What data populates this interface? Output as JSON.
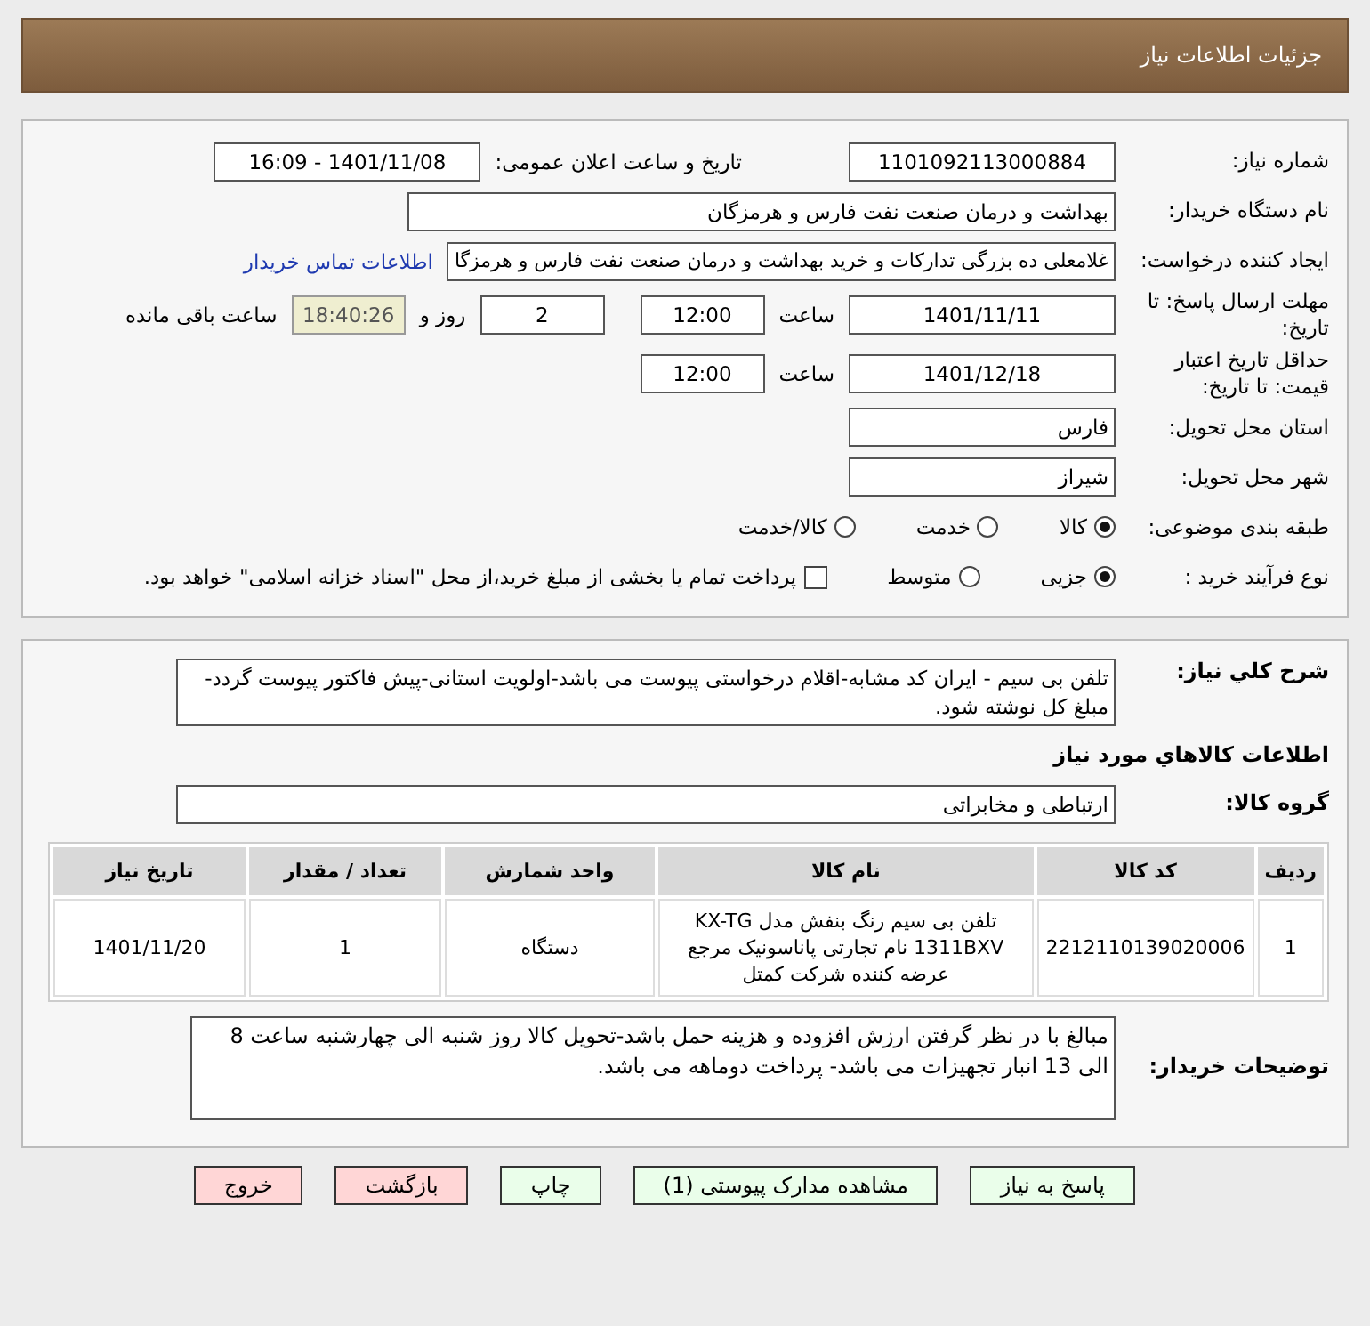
{
  "header": {
    "title": "جزئیات اطلاعات نیاز"
  },
  "need_number": {
    "label": "شماره نیاز:",
    "value": "1101092113000884"
  },
  "announce": {
    "label": "تاریخ و ساعت اعلان عمومی:",
    "value": "1401/11/08 - 16:09"
  },
  "buyer_org": {
    "label": "نام دستگاه خریدار:",
    "value": "بهداشت و درمان صنعت نفت فارس و هرمزگان"
  },
  "requester": {
    "label": "ایجاد کننده درخواست:",
    "value": "غلامعلی ده بزرگی تدارکات و خرید بهداشت و درمان صنعت نفت فارس و هرمزگا",
    "link": "اطلاعات تماس خریدار"
  },
  "reply_deadline": {
    "label": "مهلت ارسال پاسخ: تا تاریخ:",
    "date": "1401/11/11",
    "time_label": "ساعت",
    "time": "12:00",
    "days": "2",
    "days_label": "روز و",
    "remaining": "18:40:26",
    "remaining_label": "ساعت باقی مانده"
  },
  "price_validity": {
    "label": "حداقل تاریخ اعتبار قیمت: تا تاریخ:",
    "date": "1401/12/18",
    "time_label": "ساعت",
    "time": "12:00"
  },
  "province": {
    "label": "استان محل تحویل:",
    "value": "فارس"
  },
  "city": {
    "label": "شهر محل تحویل:",
    "value": "شیراز"
  },
  "category": {
    "label": "طبقه بندی موضوعی:",
    "options": [
      {
        "label": "کالا",
        "selected": true
      },
      {
        "label": "خدمت",
        "selected": false
      },
      {
        "label": "کالا/خدمت",
        "selected": false
      }
    ]
  },
  "process": {
    "label": "نوع فرآیند خرید :",
    "options": [
      {
        "label": "جزیی",
        "selected": true
      },
      {
        "label": "متوسط",
        "selected": false
      }
    ],
    "payment": {
      "label": "پرداخت تمام یا بخشی از مبلغ خرید،از محل \"اسناد خزانه اسلامی\" خواهد بود.",
      "checked": false
    }
  },
  "description": {
    "label": "شرح کلي نياز:",
    "value": "تلفن بی سیم - ایران کد مشابه-اقلام درخواستی پیوست می باشد-اولویت استانی-پیش فاکتور پیوست گردد-مبلغ کل نوشته شود."
  },
  "goods_title": "اطلاعات کالاهاي مورد نياز",
  "goods_group": {
    "label": "گروه کالا:",
    "value": "ارتباطی و مخابراتی"
  },
  "table": {
    "columns": [
      "ردیف",
      "کد کالا",
      "نام کالا",
      "واحد شمارش",
      "تعداد / مقدار",
      "تاریخ نیاز"
    ],
    "rows": [
      [
        "1",
        "2212110139020006",
        "تلفن بی سیم رنگ بنفش مدل KX-TG 1311BXV نام تجارتی پاناسونیک مرجع عرضه کننده شرکت کمتل",
        "دستگاه",
        "1",
        "1401/11/20"
      ]
    ]
  },
  "buyer_notes": {
    "label": "توضیحات خریدار:",
    "value": "مبالغ با در نظر گرفتن ارزش افزوده و هزینه حمل باشد-تحویل کالا روز شنبه الی چهارشنبه ساعت 8 الی 13 انبار تجهیزات می باشد- پرداخت دوماهه می باشد."
  },
  "buttons": [
    {
      "label": "پاسخ به نیاز",
      "kind": "action"
    },
    {
      "label": "مشاهده مدارک پیوستی (1)",
      "kind": "action"
    },
    {
      "label": "چاپ",
      "kind": "action"
    },
    {
      "label": "بازگشت",
      "kind": "exit"
    },
    {
      "label": "خروج",
      "kind": "exit"
    }
  ]
}
